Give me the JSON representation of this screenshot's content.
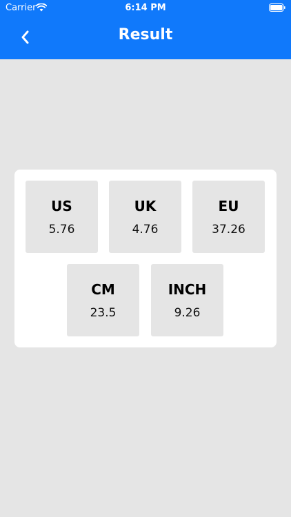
{
  "status_bar": {
    "carrier": "Carrier",
    "time": "6:14 PM",
    "wifi_icon": "wifi-icon",
    "battery_icon": "battery-icon"
  },
  "nav": {
    "title": "Result",
    "back_icon": "chevron-left-icon"
  },
  "results": [
    {
      "label": "US",
      "value": "5.76"
    },
    {
      "label": "UK",
      "value": "4.76"
    },
    {
      "label": "EU",
      "value": "37.26"
    },
    {
      "label": "CM",
      "value": "23.5"
    },
    {
      "label": "INCH",
      "value": "9.26"
    }
  ],
  "colors": {
    "nav_background": "#1079fb",
    "page_background": "#e5e5e5",
    "card_background": "#ffffff",
    "box_background": "#e5e5e5"
  }
}
